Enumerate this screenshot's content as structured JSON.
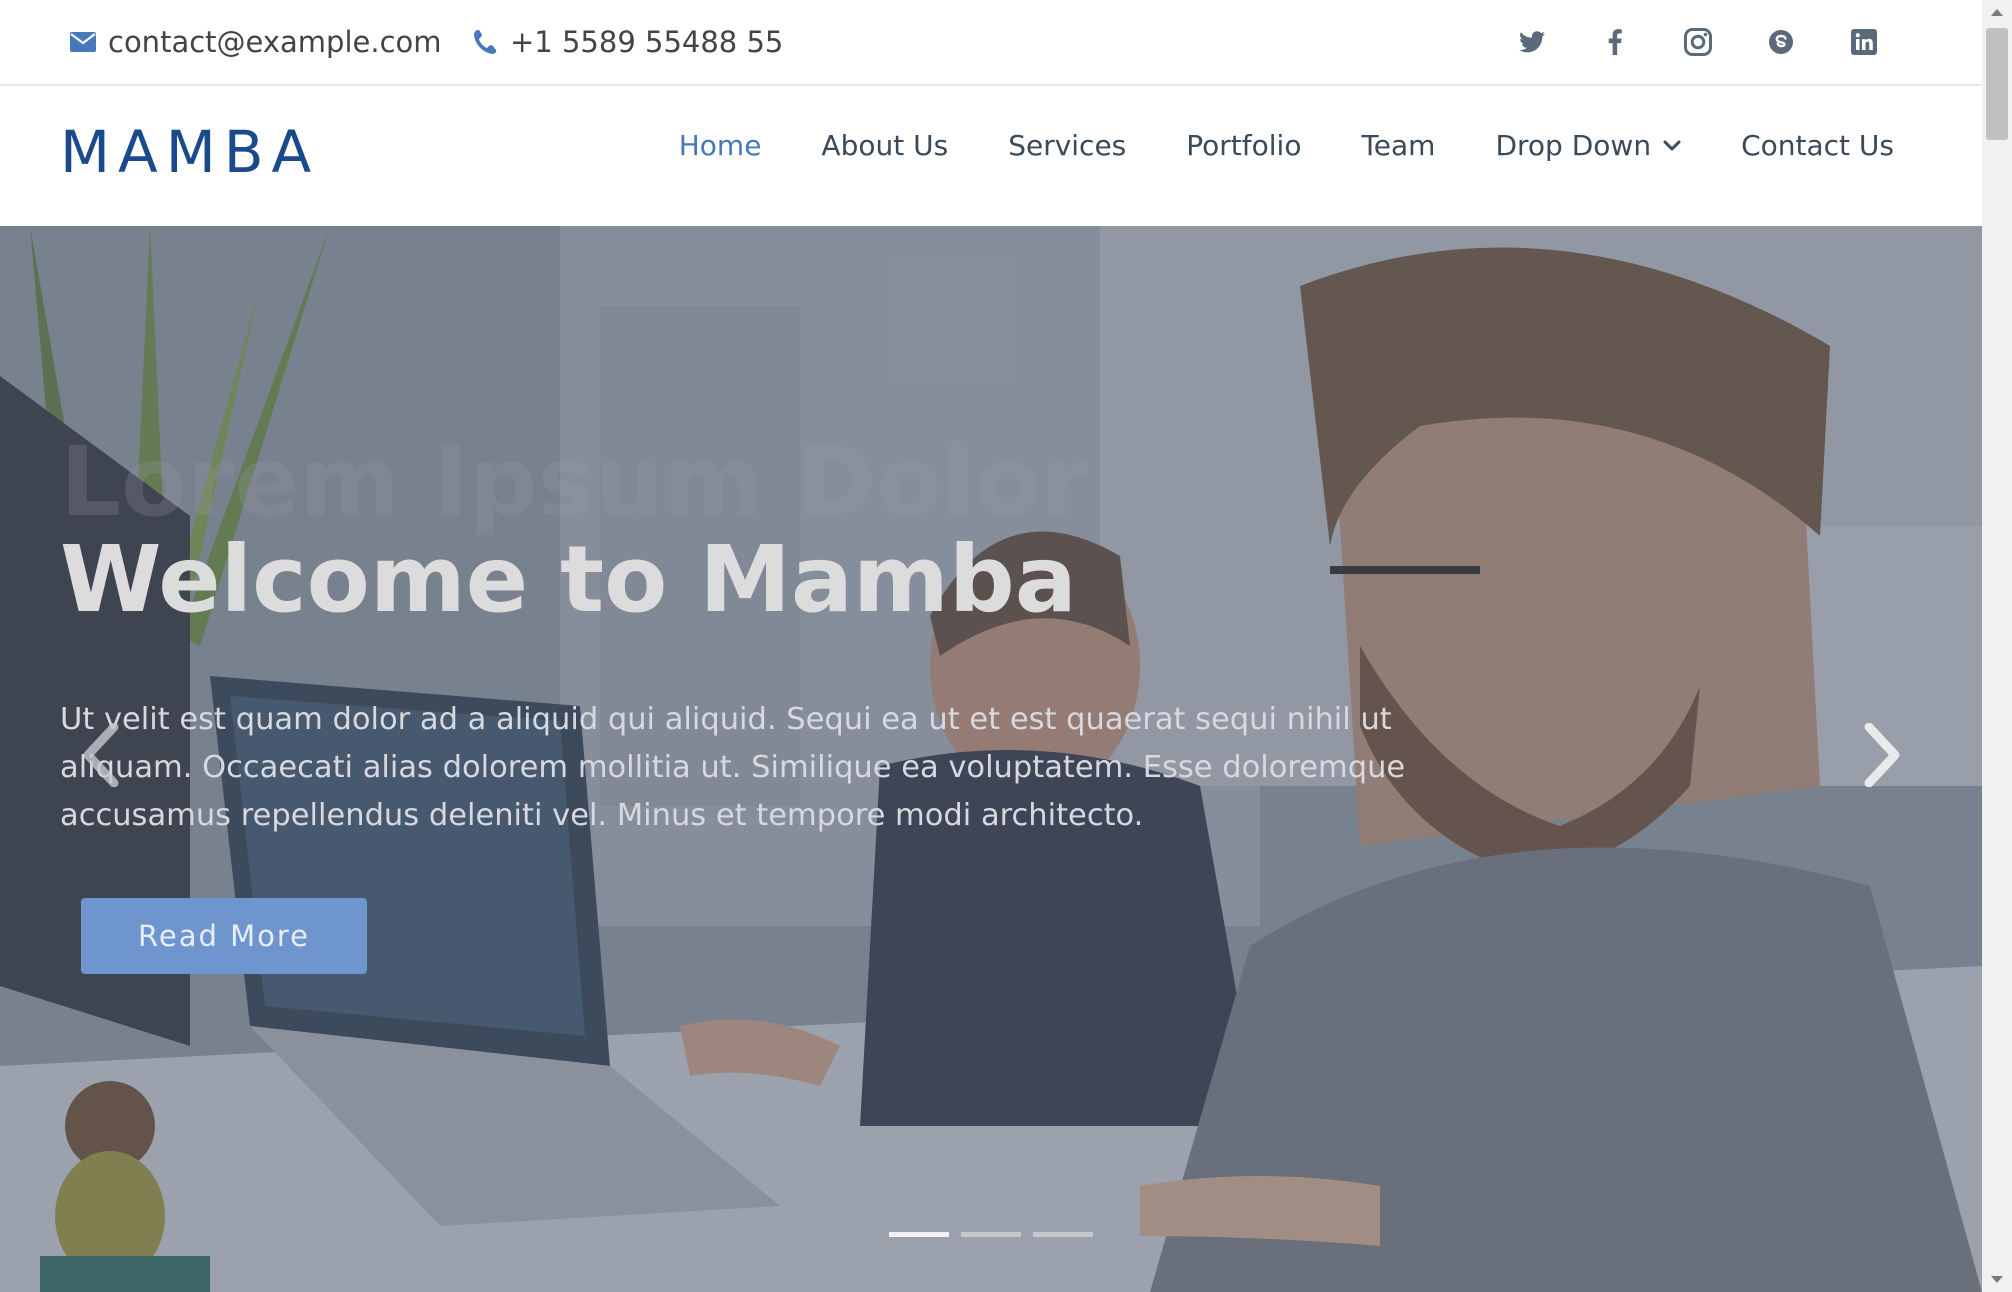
{
  "topbar": {
    "email": "contact@example.com",
    "phone": "+1 5589 55488 55",
    "socials": [
      "twitter-icon",
      "facebook-icon",
      "instagram-icon",
      "skype-icon",
      "linkedin-icon"
    ]
  },
  "header": {
    "logo": "MAMBA",
    "nav": [
      {
        "label": "Home",
        "active": true
      },
      {
        "label": "About Us"
      },
      {
        "label": "Services"
      },
      {
        "label": "Portfolio"
      },
      {
        "label": "Team"
      },
      {
        "label": "Drop Down",
        "has_dropdown": true
      },
      {
        "label": "Contact Us"
      }
    ]
  },
  "hero": {
    "ghost_title": "Lorem Ipsum Dolor",
    "title": "Welcome to Mamba",
    "text": "Ut velit est quam dolor ad a aliquid qui aliquid. Sequi ea ut et est quaerat sequi nihil ut aliquam. Occaecati alias dolorem mollitia ut. Similique ea voluptatem. Esse doloremque accusamus repellendus deleniti vel. Minus et tempore modi architecto.",
    "button": "Read More",
    "slides": 3,
    "active_slide": 1
  },
  "colors": {
    "accent": "#4679b9",
    "logo": "#1a4a8c",
    "button": "#6f95cf"
  }
}
